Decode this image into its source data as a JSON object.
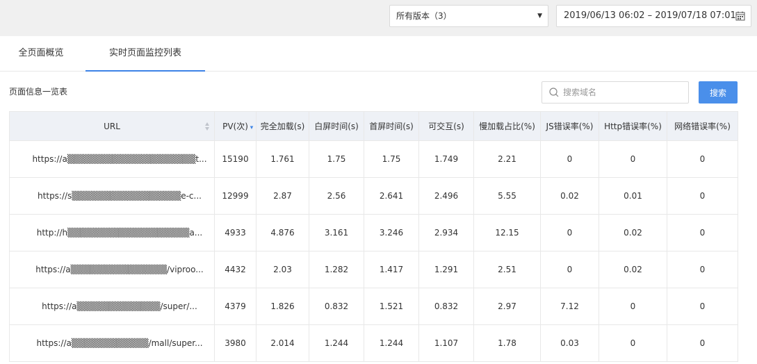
{
  "toolbar": {
    "version_select": "所有版本（3）",
    "date_range": "2019/06/13 06:02 – 2019/07/18 07:01"
  },
  "tabs": [
    {
      "label": "全页面概览",
      "active": false
    },
    {
      "label": "实时页面监控列表",
      "active": true
    }
  ],
  "section_title": "页面信息一览表",
  "search": {
    "placeholder": "搜索域名",
    "button": "搜索"
  },
  "colors": {
    "accent": "#3c82e6",
    "button": "#4a8fea",
    "header_bg": "#eef1f6"
  },
  "table": {
    "columns": [
      "URL",
      "PV(次)",
      "完全加载(s)",
      "白屏时间(s)",
      "首屏时间(s)",
      "可交互(s)",
      "慢加载占比(%)",
      "JS错误率(%)",
      "Http错误率(%)",
      "网络错误率(%)"
    ],
    "rows": [
      [
        "https://a▒▒▒▒▒▒▒▒▒▒▒▒▒▒▒▒▒▒▒▒t...",
        "15190",
        "1.761",
        "1.75",
        "1.75",
        "1.749",
        "2.21",
        "0",
        "0",
        "0"
      ],
      [
        "https://s▒▒▒▒▒▒▒▒▒▒▒▒▒▒▒▒▒e-c...",
        "12999",
        "2.87",
        "2.56",
        "2.641",
        "2.496",
        "5.55",
        "0.02",
        "0.01",
        "0"
      ],
      [
        "http://h▒▒▒▒▒▒▒▒▒▒▒▒▒▒▒▒▒▒▒a...",
        "4933",
        "4.876",
        "3.161",
        "3.246",
        "2.934",
        "12.15",
        "0",
        "0.02",
        "0"
      ],
      [
        "https://a▒▒▒▒▒▒▒▒▒▒▒▒▒▒▒/viproo...",
        "4432",
        "2.03",
        "1.282",
        "1.417",
        "1.291",
        "2.51",
        "0",
        "0.02",
        "0"
      ],
      [
        "https://a▒▒▒▒▒▒▒▒▒▒▒▒▒/super/...",
        "4379",
        "1.826",
        "0.832",
        "1.521",
        "0.832",
        "2.97",
        "7.12",
        "0",
        "0"
      ],
      [
        "https://a▒▒▒▒▒▒▒▒▒▒▒▒/mall/super...",
        "3980",
        "2.014",
        "1.244",
        "1.244",
        "1.107",
        "1.78",
        "0.03",
        "0",
        "0"
      ]
    ]
  }
}
